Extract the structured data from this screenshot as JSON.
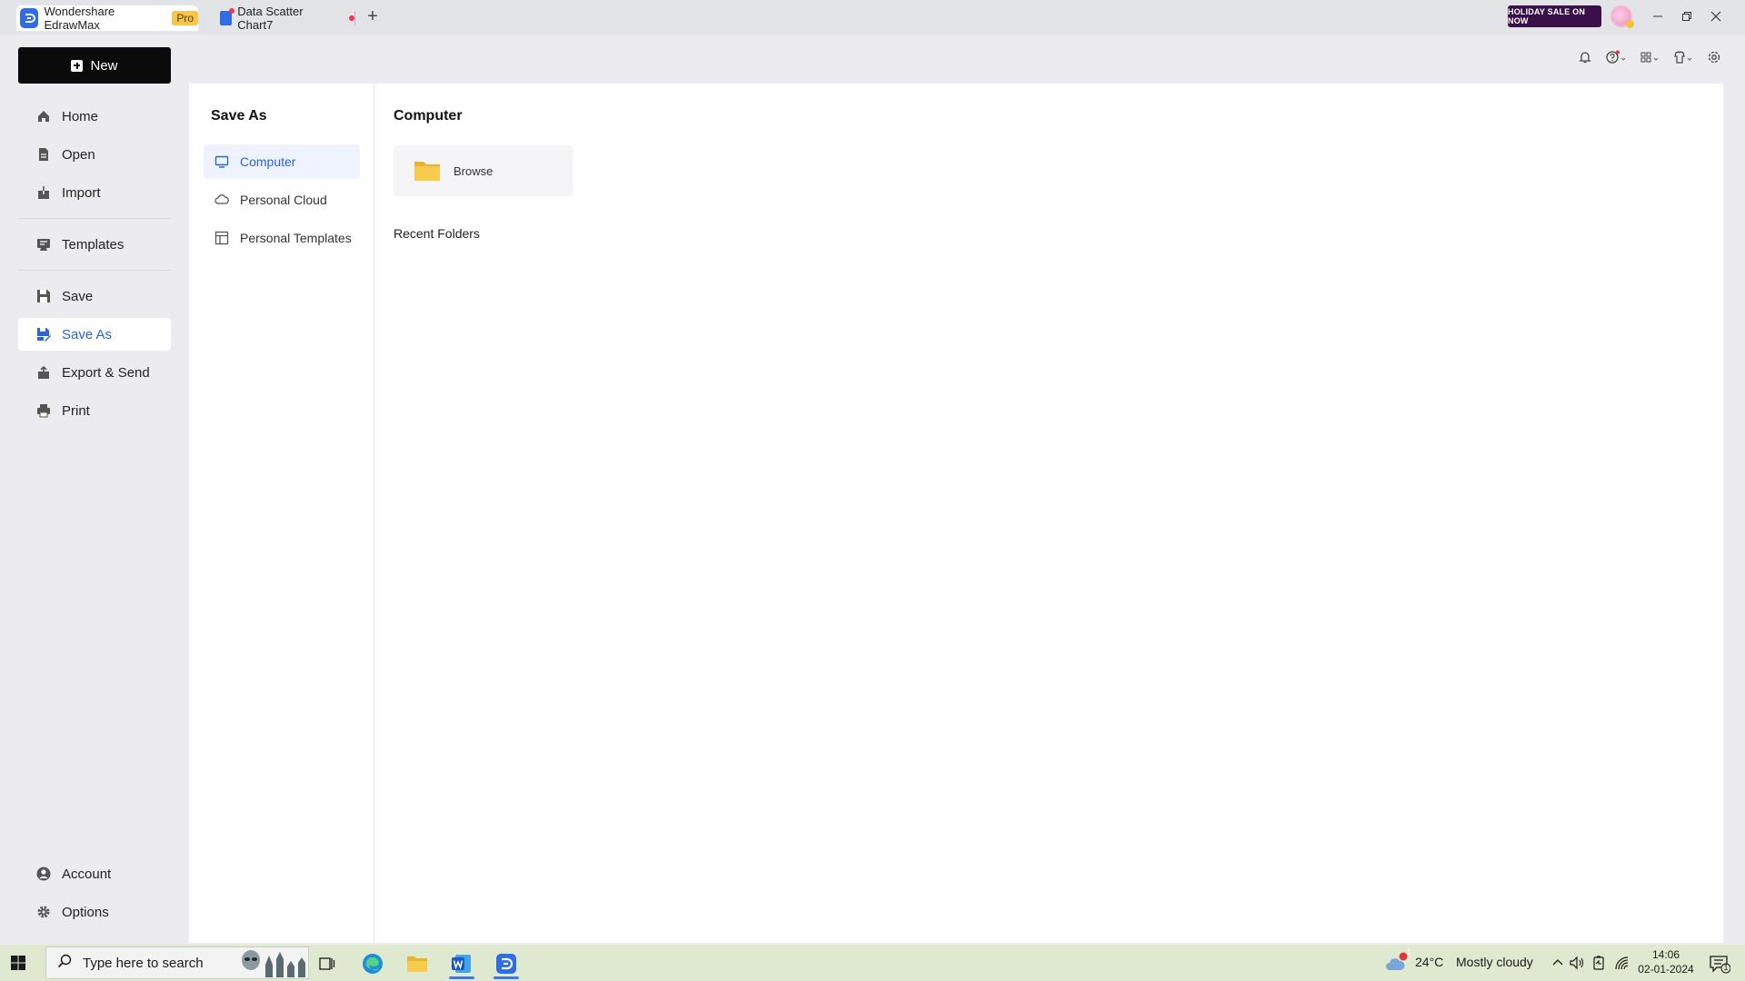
{
  "window": {
    "app_tab_title": "Wondershare EdrawMax",
    "pro_badge": "Pro",
    "doc_tab_title": "Data Scatter Chart7",
    "sale_banner": "HOLIDAY SALE ON NOW"
  },
  "sidebar": {
    "new_label": "New",
    "items": [
      {
        "label": "Home",
        "icon": "home-icon"
      },
      {
        "label": "Open",
        "icon": "file-icon"
      },
      {
        "label": "Import",
        "icon": "import-icon"
      },
      {
        "label": "Templates",
        "icon": "templates-icon"
      },
      {
        "label": "Save",
        "icon": "save-icon"
      },
      {
        "label": "Save As",
        "icon": "save-as-icon",
        "active": true
      },
      {
        "label": "Export & Send",
        "icon": "export-icon"
      },
      {
        "label": "Print",
        "icon": "print-icon"
      }
    ],
    "bottom_items": [
      {
        "label": "Account",
        "icon": "user-icon"
      },
      {
        "label": "Options",
        "icon": "gear-icon"
      }
    ]
  },
  "save_as": {
    "title": "Save As",
    "locations": [
      {
        "label": "Computer",
        "icon": "monitor-icon",
        "active": true
      },
      {
        "label": "Personal Cloud",
        "icon": "cloud-icon"
      },
      {
        "label": "Personal Templates",
        "icon": "template-layout-icon"
      }
    ]
  },
  "computer": {
    "title": "Computer",
    "browse_label": "Browse",
    "recent_folders_label": "Recent Folders"
  },
  "taskbar": {
    "search_placeholder": "Type here to search",
    "weather_temp": "24°C",
    "weather_desc": "Mostly cloudy",
    "time": "14:06",
    "date": "02-01-2024",
    "notification_count": "1"
  },
  "colors": {
    "accent": "#2b63d9",
    "new_button_bg": "#0b0b0b",
    "taskbar_bg": "#dfe9cf"
  }
}
